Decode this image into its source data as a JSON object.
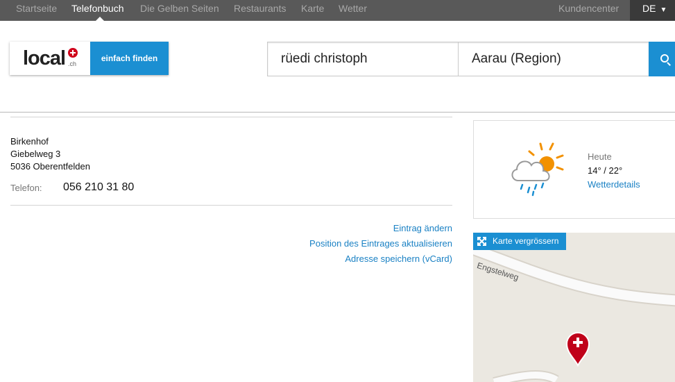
{
  "topnav": {
    "items": [
      {
        "label": "Startseite",
        "active": false
      },
      {
        "label": "Telefonbuch",
        "active": true
      },
      {
        "label": "Die Gelben Seiten",
        "active": false
      },
      {
        "label": "Restaurants",
        "active": false
      },
      {
        "label": "Karte",
        "active": false
      },
      {
        "label": "Wetter",
        "active": false
      }
    ],
    "kundencenter": "Kundencenter",
    "language": "DE",
    "language_arrow": "▼"
  },
  "logo": {
    "word": "local",
    "suffix": ".ch",
    "tagline": "einfach finden"
  },
  "search": {
    "what_value": "rüedi christoph",
    "where_value": "Aarau (Region)",
    "button_icon": "search-icon"
  },
  "entry": {
    "address_lines": [
      "Birkenhof",
      "Giebelweg 3",
      "5036 Oberentfelden"
    ],
    "phone_label": "Telefon:",
    "phone_value": "056 210 31 80"
  },
  "actions": {
    "edit": "Eintrag ändern",
    "update_position": "Position des Eintrages aktualisieren",
    "save_vcard": "Adresse speichern (vCard)"
  },
  "weather": {
    "icon": "sun-cloud-rain-icon",
    "day_label": "Heute",
    "temperature": "14° / 22°",
    "details_link": "Wetterdetails"
  },
  "map": {
    "enlarge_label": "Karte vergrössern",
    "road_name": "Engstelweg",
    "pin_icon": "swiss-cross-pin-icon"
  },
  "colors": {
    "nav_bg": "#595959",
    "brand_blue": "#1b8fd2",
    "link_blue": "#1a81c4",
    "pin_red": "#c0021a",
    "sun_orange": "#f29100"
  }
}
